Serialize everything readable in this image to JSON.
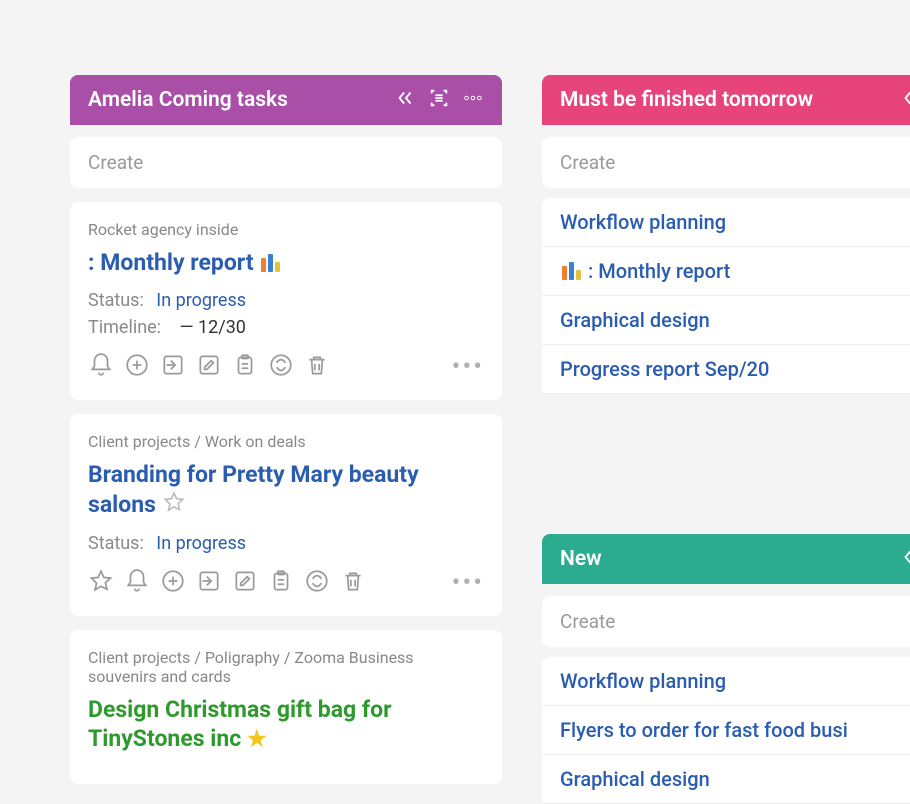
{
  "columns": {
    "left": {
      "title": "Amelia Coming tasks",
      "create": "Create",
      "cards": [
        {
          "breadcrumb": "Rocket agency inside",
          "titlePrefix": ": Monthly report",
          "statusLabel": "Status:",
          "statusValue": "In progress",
          "timelineLabel": "Timeline:",
          "timelineValue": "— 12/30"
        },
        {
          "breadcrumb": "Client projects / Work on deals",
          "title": "Branding for Pretty Mary beauty salons",
          "statusLabel": "Status:",
          "statusValue": "In progress"
        },
        {
          "breadcrumb": "Client projects / Poligraphy / Zooma Business souvenirs and cards",
          "title": "Design Christmas gift bag for TinyStones inc"
        }
      ]
    },
    "right": {
      "section1": {
        "title": "Must be finished tomorrow",
        "create": "Create",
        "items": [
          "Workflow planning",
          ": Monthly report",
          "Graphical design",
          "Progress report Sep/20"
        ]
      },
      "section2": {
        "title": "New",
        "create": "Create",
        "items": [
          "Workflow planning",
          "Flyers to order for fast food busi",
          "Graphical design"
        ]
      }
    }
  }
}
